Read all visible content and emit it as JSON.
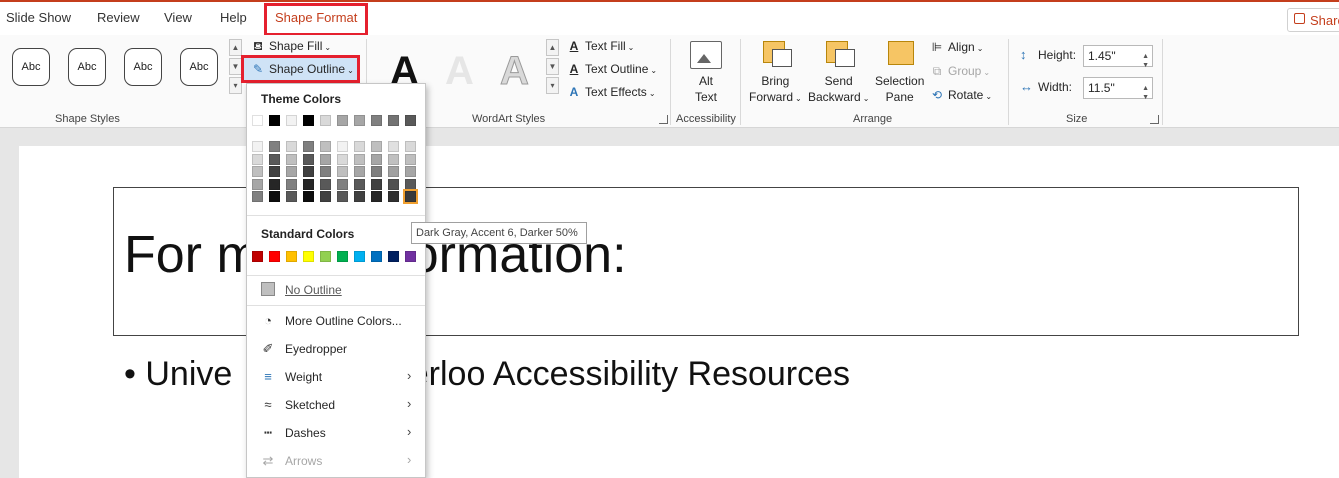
{
  "tabs": [
    {
      "label": "Slide Show"
    },
    {
      "label": "Review"
    },
    {
      "label": "View"
    },
    {
      "label": "Help"
    },
    {
      "label": "Shape Format"
    }
  ],
  "share_label": "Share",
  "colors": {
    "accent": "#c43e1c",
    "highlight_box": "#e5202e"
  },
  "shape_styles": {
    "tiles": [
      "Abc",
      "Abc",
      "Abc",
      "Abc"
    ],
    "fill_label": "Shape Fill",
    "outline_label": "Shape Outline",
    "group_label": "Shape Styles"
  },
  "wordart": {
    "letters": [
      "A",
      "A",
      "A"
    ],
    "text_fill": "Text Fill",
    "text_outline": "Text Outline",
    "text_effects": "Text Effects",
    "group_label": "WordArt Styles"
  },
  "accessibility": {
    "button": "Alt Text",
    "line1": "Alt",
    "line2": "Text",
    "group_label": "Accessibility"
  },
  "arrange": {
    "bring_forward": [
      "Bring",
      "Forward"
    ],
    "send_backward": [
      "Send",
      "Backward"
    ],
    "selection_pane": [
      "Selection",
      "Pane"
    ],
    "align": "Align",
    "group": "Group",
    "rotate": "Rotate",
    "group_label": "Arrange"
  },
  "size": {
    "height_label": "Height:",
    "height_value": "1.45\"",
    "width_label": "Width:",
    "width_value": "11.5\"",
    "group_label": "Size"
  },
  "outline_menu": {
    "theme_colors_label": "Theme Colors",
    "standard_colors_label": "Standard Colors",
    "theme_top_row": [
      "#ffffff",
      "#000000",
      "#f2f2f2",
      "#000000",
      "#d9d9d9",
      "#a6a6a6",
      "#a6a6a6",
      "#808080",
      "#737373",
      "#595959"
    ],
    "theme_columns": [
      [
        "#f2f2f2",
        "#d9d9d9",
        "#bfbfbf",
        "#a6a6a6",
        "#808080"
      ],
      [
        "#808080",
        "#595959",
        "#404040",
        "#262626",
        "#0d0d0d"
      ],
      [
        "#d9d9d9",
        "#bfbfbf",
        "#a6a6a6",
        "#808080",
        "#595959"
      ],
      [
        "#7f7f7f",
        "#595959",
        "#404040",
        "#262626",
        "#0d0d0d"
      ],
      [
        "#bfbfbf",
        "#a6a6a6",
        "#808080",
        "#595959",
        "#404040"
      ],
      [
        "#f2f2f2",
        "#d9d9d9",
        "#bfbfbf",
        "#808080",
        "#595959"
      ],
      [
        "#d9d9d9",
        "#bfbfbf",
        "#a6a6a6",
        "#595959",
        "#404040"
      ],
      [
        "#bfbfbf",
        "#a6a6a6",
        "#7f7f7f",
        "#404040",
        "#262626"
      ],
      [
        "#e0e0e0",
        "#c0c0c0",
        "#a0a0a0",
        "#505050",
        "#303030"
      ],
      [
        "#d9d9d9",
        "#bfbfbf",
        "#a6a6a6",
        "#595959",
        "#3a3a3a"
      ]
    ],
    "standard_colors": [
      "#c00000",
      "#ff0000",
      "#ffc000",
      "#ffff00",
      "#92d050",
      "#00b050",
      "#00b0f0",
      "#0070c0",
      "#002060",
      "#7030a0"
    ],
    "items": [
      {
        "label": "No Outline",
        "icon": "no-outline-icon"
      },
      {
        "label": "More Outline Colors...",
        "icon": "palette-icon"
      },
      {
        "label": "Eyedropper",
        "icon": "eyedropper-icon"
      },
      {
        "label": "Weight",
        "icon": "weight-icon"
      },
      {
        "label": "Sketched",
        "icon": "sketched-icon"
      },
      {
        "label": "Dashes",
        "icon": "dashes-icon"
      },
      {
        "label": "Arrows",
        "icon": "arrows-icon"
      }
    ],
    "tooltip": "Dark Gray, Accent 6, Darker 50%"
  },
  "slide": {
    "title_left": "For m",
    "title_right": "ormation:",
    "bullet": "•",
    "bullet_left": "Unive",
    "bullet_right": "terloo Accessibility Resources"
  }
}
